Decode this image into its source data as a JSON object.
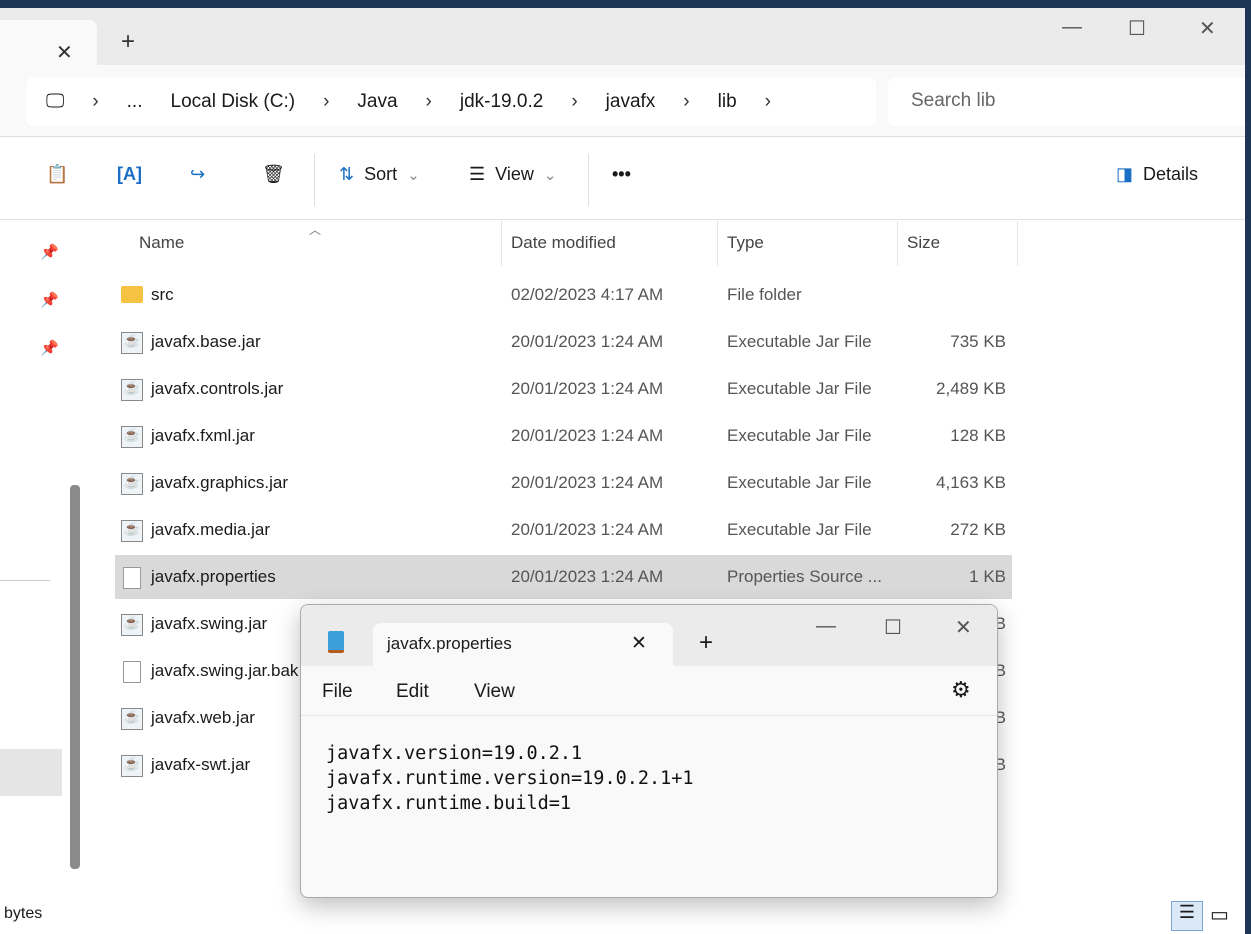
{
  "explorer": {
    "breadcrumb": [
      "...",
      "Local Disk (C:)",
      "Java",
      "jdk-19.0.2",
      "javafx",
      "lib"
    ],
    "search_placeholder": "Search lib",
    "toolbar": {
      "sort": "Sort",
      "view": "View",
      "more": "•••",
      "details": "Details"
    },
    "columns": {
      "name": "Name",
      "date": "Date modified",
      "type": "Type",
      "size": "Size"
    },
    "files": [
      {
        "name": "src",
        "date": "02/02/2023 4:17 AM",
        "type": "File folder",
        "size": "",
        "icon": "folder"
      },
      {
        "name": "javafx.base.jar",
        "date": "20/01/2023 1:24 AM",
        "type": "Executable Jar File",
        "size": "735 KB",
        "icon": "jar"
      },
      {
        "name": "javafx.controls.jar",
        "date": "20/01/2023 1:24 AM",
        "type": "Executable Jar File",
        "size": "2,489 KB",
        "icon": "jar"
      },
      {
        "name": "javafx.fxml.jar",
        "date": "20/01/2023 1:24 AM",
        "type": "Executable Jar File",
        "size": "128 KB",
        "icon": "jar"
      },
      {
        "name": "javafx.graphics.jar",
        "date": "20/01/2023 1:24 AM",
        "type": "Executable Jar File",
        "size": "4,163 KB",
        "icon": "jar"
      },
      {
        "name": "javafx.media.jar",
        "date": "20/01/2023 1:24 AM",
        "type": "Executable Jar File",
        "size": "272 KB",
        "icon": "jar"
      },
      {
        "name": "javafx.properties",
        "date": "20/01/2023 1:24 AM",
        "type": "Properties Source ...",
        "size": "1 KB",
        "icon": "file",
        "selected": true
      },
      {
        "name": "javafx.swing.jar",
        "date": "",
        "type": "",
        "size": "B",
        "icon": "jar"
      },
      {
        "name": "javafx.swing.jar.bak",
        "date": "",
        "type": "",
        "size": "B",
        "icon": "file"
      },
      {
        "name": "javafx.web.jar",
        "date": "",
        "type": "",
        "size": "B",
        "icon": "jar"
      },
      {
        "name": "javafx-swt.jar",
        "date": "",
        "type": "",
        "size": "B",
        "icon": "jar"
      }
    ],
    "status": "bytes"
  },
  "notepad": {
    "tab_title": "javafx.properties",
    "menu": [
      "File",
      "Edit",
      "View"
    ],
    "content": "javafx.version=19.0.2.1\njavafx.runtime.version=19.0.2.1+1\njavafx.runtime.build=1"
  }
}
